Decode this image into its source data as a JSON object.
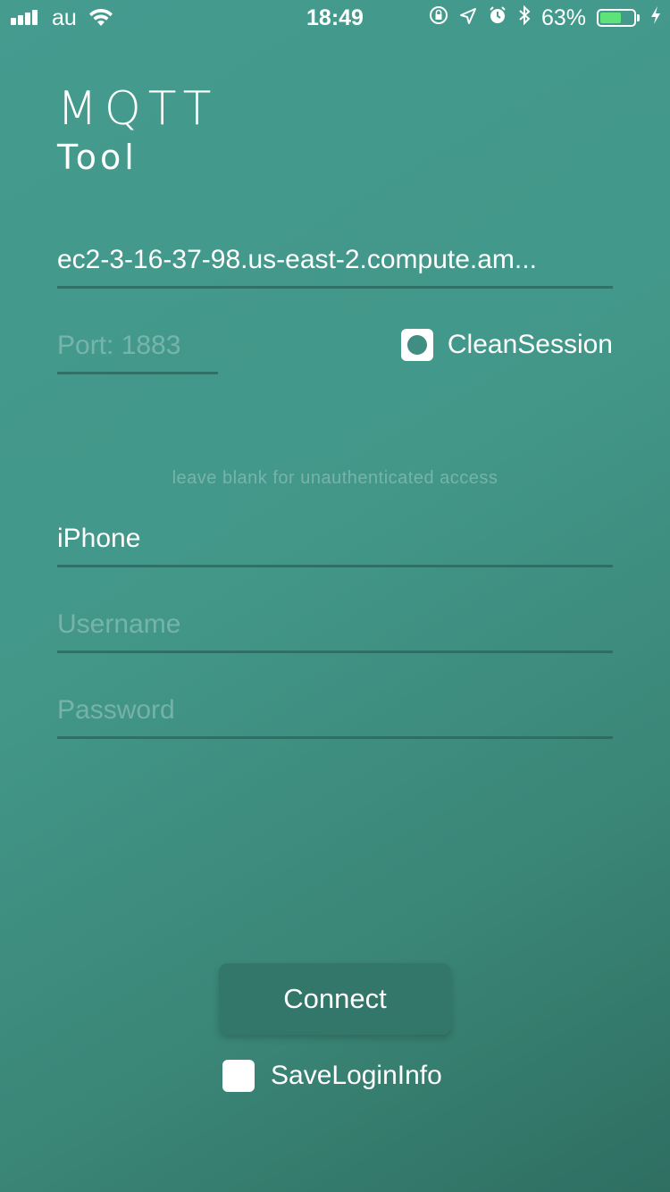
{
  "status_bar": {
    "carrier": "au",
    "time": "18:49",
    "battery_percent": "63%",
    "battery_level": 0.63,
    "battery_color": "#5de37a",
    "icons": [
      "signal-icon",
      "wifi-icon",
      "orientation-lock-icon",
      "location-icon",
      "alarm-icon",
      "bluetooth-icon",
      "battery-icon",
      "charging-icon"
    ]
  },
  "logo": {
    "line1": "MQTT",
    "line2": "Tool"
  },
  "form": {
    "host_value": "ec2-3-16-37-98.us-east-2.compute.am...",
    "port_placeholder": "Port: 1883",
    "clean_session_label": "CleanSession",
    "clean_session_checked": true,
    "hint": "leave blank for unauthenticated access",
    "client_id_value": "iPhone",
    "username_placeholder": "Username",
    "password_placeholder": "Password"
  },
  "actions": {
    "connect_label": "Connect",
    "save_login_label": "SaveLoginInfo",
    "save_login_checked": false
  },
  "colors": {
    "background_start": "#449b8e",
    "background_end": "#2e6f62",
    "button_bg": "#33766a"
  }
}
